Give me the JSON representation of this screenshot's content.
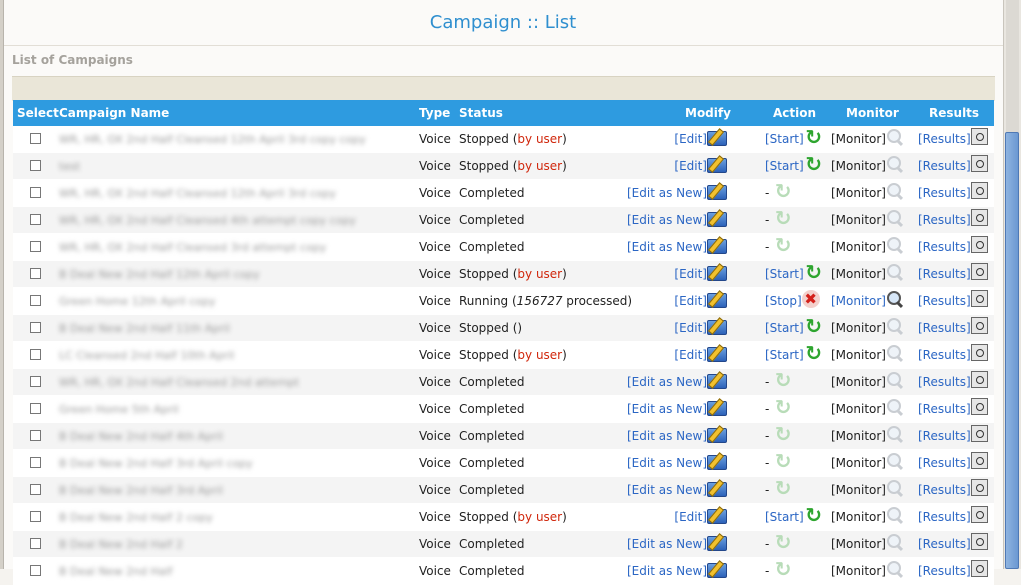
{
  "page": {
    "title": "Campaign :: List",
    "section_label": "List of Campaigns"
  },
  "table": {
    "headers": [
      "Select",
      "Campaign Name",
      "Type",
      "Status",
      "Modify",
      "Action",
      "Monitor",
      "Results"
    ],
    "rows": [
      {
        "name": "WR, HR, OX 2nd Half Cleansed 12th April 3rd copy copy",
        "type": "Voice",
        "status_main": "Stopped (",
        "status_extra": "by user",
        "status_tail": ")",
        "modify": "[Edit]",
        "action": "[Start]",
        "action_state": "on",
        "monitor": "[Monitor]",
        "monitor_link": false,
        "results": "[Results]"
      },
      {
        "name": "test",
        "type": "Voice",
        "status_main": "Stopped (",
        "status_extra": "by user",
        "status_tail": ")",
        "modify": "[Edit]",
        "action": "[Start]",
        "action_state": "on",
        "monitor": "[Monitor]",
        "monitor_link": false,
        "results": "[Results]"
      },
      {
        "name": "WR, HR, OX 2nd Half Cleansed 12th April 3rd copy",
        "type": "Voice",
        "status_main": "Completed",
        "status_extra": "",
        "status_tail": "",
        "modify": "[Edit as New]",
        "action": "-",
        "action_state": "off",
        "monitor": "[Monitor]",
        "monitor_link": false,
        "results": "[Results]"
      },
      {
        "name": "WR, HR, OX 2nd Half Cleansed 4th attempt copy copy",
        "type": "Voice",
        "status_main": "Completed",
        "status_extra": "",
        "status_tail": "",
        "modify": "[Edit as New]",
        "action": "-",
        "action_state": "off",
        "monitor": "[Monitor]",
        "monitor_link": false,
        "results": "[Results]"
      },
      {
        "name": "WR, HR, OX 2nd Half Cleansed 3rd attempt copy",
        "type": "Voice",
        "status_main": "Completed",
        "status_extra": "",
        "status_tail": "",
        "modify": "[Edit as New]",
        "action": "-",
        "action_state": "off",
        "monitor": "[Monitor]",
        "monitor_link": false,
        "results": "[Results]"
      },
      {
        "name": "B Deal New 2nd Half 12th April copy",
        "type": "Voice",
        "status_main": "Stopped (",
        "status_extra": "by user",
        "status_tail": ")",
        "modify": "[Edit]",
        "action": "[Start]",
        "action_state": "on",
        "monitor": "[Monitor]",
        "monitor_link": false,
        "results": "[Results]"
      },
      {
        "name": "Green Home 12th April copy",
        "type": "Voice",
        "status_main": "Running (",
        "status_extra": "156727",
        "status_tail": " processed)",
        "modify": "[Edit]",
        "action": "[Stop]",
        "action_state": "stop",
        "monitor": "[Monitor]",
        "monitor_link": true,
        "results": "[Results]"
      },
      {
        "name": "B Deal New 2nd Half 11th April",
        "type": "Voice",
        "status_main": "Stopped ()",
        "status_extra": "",
        "status_tail": "",
        "modify": "[Edit]",
        "action": "[Start]",
        "action_state": "on",
        "monitor": "[Monitor]",
        "monitor_link": false,
        "results": "[Results]"
      },
      {
        "name": "LC Cleansed 2nd Half 10th April",
        "type": "Voice",
        "status_main": "Stopped (",
        "status_extra": "by user",
        "status_tail": ")",
        "modify": "[Edit]",
        "action": "[Start]",
        "action_state": "on",
        "monitor": "[Monitor]",
        "monitor_link": false,
        "results": "[Results]"
      },
      {
        "name": "WR, HR, OX 2nd Half Cleansed 2nd attempt",
        "type": "Voice",
        "status_main": "Completed",
        "status_extra": "",
        "status_tail": "",
        "modify": "[Edit as New]",
        "action": "-",
        "action_state": "off",
        "monitor": "[Monitor]",
        "monitor_link": false,
        "results": "[Results]"
      },
      {
        "name": "Green Home 5th April",
        "type": "Voice",
        "status_main": "Completed",
        "status_extra": "",
        "status_tail": "",
        "modify": "[Edit as New]",
        "action": "-",
        "action_state": "off",
        "monitor": "[Monitor]",
        "monitor_link": false,
        "results": "[Results]"
      },
      {
        "name": "B Deal New 2nd Half 4th April",
        "type": "Voice",
        "status_main": "Completed",
        "status_extra": "",
        "status_tail": "",
        "modify": "[Edit as New]",
        "action": "-",
        "action_state": "off",
        "monitor": "[Monitor]",
        "monitor_link": false,
        "results": "[Results]"
      },
      {
        "name": "B Deal New 2nd Half 3rd April copy",
        "type": "Voice",
        "status_main": "Completed",
        "status_extra": "",
        "status_tail": "",
        "modify": "[Edit as New]",
        "action": "-",
        "action_state": "off",
        "monitor": "[Monitor]",
        "monitor_link": false,
        "results": "[Results]"
      },
      {
        "name": "B Deal New 2nd Half 3rd April",
        "type": "Voice",
        "status_main": "Completed",
        "status_extra": "",
        "status_tail": "",
        "modify": "[Edit as New]",
        "action": "-",
        "action_state": "off",
        "monitor": "[Monitor]",
        "monitor_link": false,
        "results": "[Results]"
      },
      {
        "name": "B Deal New 2nd Half 2 copy",
        "type": "Voice",
        "status_main": "Stopped (",
        "status_extra": "by user",
        "status_tail": ")",
        "modify": "[Edit]",
        "action": "[Start]",
        "action_state": "on",
        "monitor": "[Monitor]",
        "monitor_link": false,
        "results": "[Results]"
      },
      {
        "name": "B Deal New 2nd Half 2",
        "type": "Voice",
        "status_main": "Completed",
        "status_extra": "",
        "status_tail": "",
        "modify": "[Edit as New]",
        "action": "-",
        "action_state": "off",
        "monitor": "[Monitor]",
        "monitor_link": false,
        "results": "[Results]"
      },
      {
        "name": "B Deal New 2nd Half",
        "type": "Voice",
        "status_main": "Completed",
        "status_extra": "",
        "status_tail": "",
        "modify": "[Edit as New]",
        "action": "-",
        "action_state": "off",
        "monitor": "[Monitor]",
        "monitor_link": false,
        "results": "[Results]"
      }
    ]
  },
  "icons": {
    "modify": "folder-edit-icon",
    "action_on": "refresh-icon",
    "action_off": "refresh-disabled-icon",
    "action_stop": "stop-x-icon",
    "monitor": "magnifier-icon",
    "results": "results-icon"
  },
  "colors": {
    "header": "#2e9be0",
    "title": "#2f8fcf",
    "link": "#2b66c4",
    "red_status": "#d0260b"
  }
}
